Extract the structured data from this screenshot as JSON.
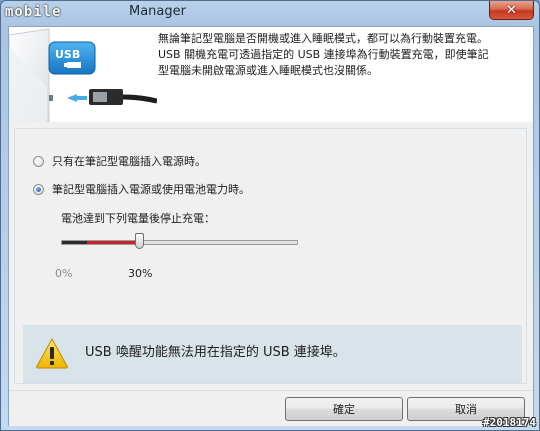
{
  "window": {
    "title_logo": "mobile",
    "title": "Manager",
    "close_glyph": "✕"
  },
  "header": {
    "icon": "usb-laptop-charging-illustration",
    "icon_badge": "USB",
    "description_lines": [
      "無論筆記型電腦是否開機或進入睡眠模式，都可以為行動裝置充電。",
      "USB 關機充電可透過指定的 USB 連接埠為行動裝置充電，即使筆記",
      "型電腦未開啟電源或進入睡眠模式也沒關係。"
    ]
  },
  "options": {
    "selected": 1,
    "items": [
      {
        "label": "只有在筆記型電腦插入電源時。"
      },
      {
        "label": "筆記型電腦插入電源或使用電池電力時。"
      }
    ]
  },
  "slider": {
    "label": "電池達到下列電量後停止充電：",
    "min_label": "0%",
    "value_label": "30%",
    "value_fraction": 0.33
  },
  "warning": {
    "icon": "warning-triangle-icon",
    "text": "USB 喚醒功能無法用在指定的 USB 連接埠。"
  },
  "buttons": {
    "ok": "確定",
    "cancel": "取消"
  },
  "watermark": "#2018174",
  "colors": {
    "accent_blue": "#1f8fd6",
    "slider_red": "#c8232c",
    "warning_yellow": "#f5c400",
    "close_red": "#c4391d"
  }
}
